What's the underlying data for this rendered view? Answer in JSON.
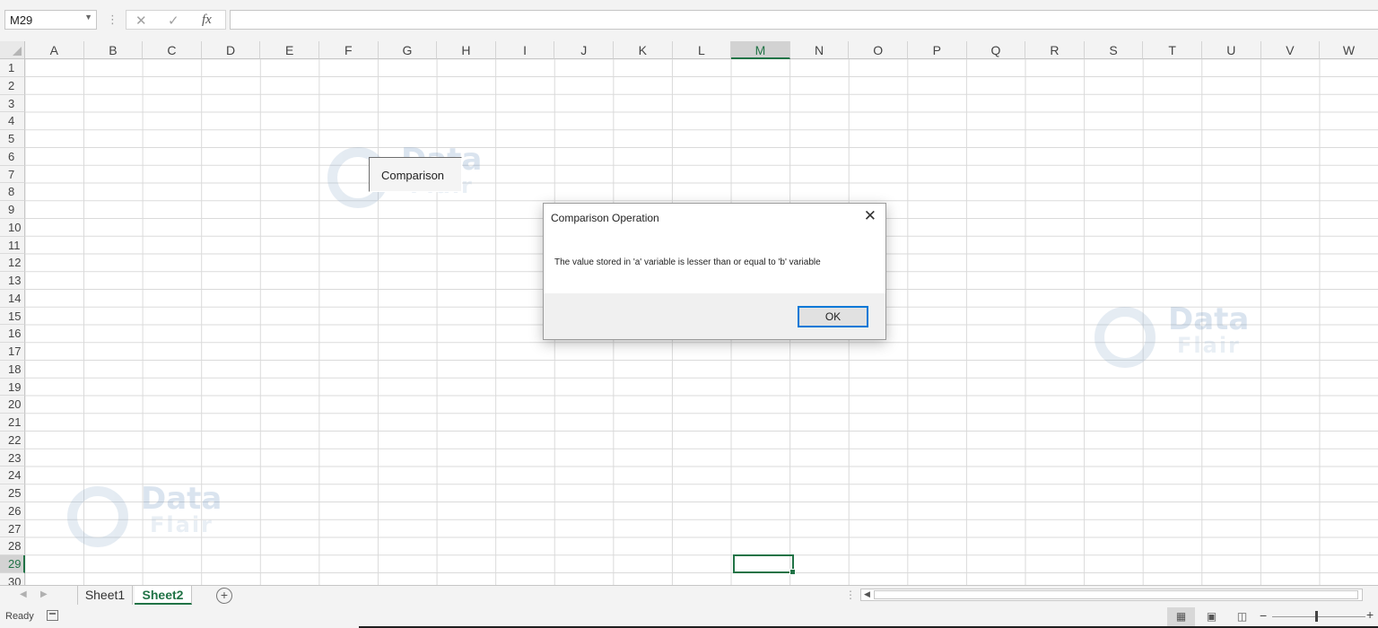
{
  "formula_bar": {
    "name_box": "M29",
    "cancel_icon": "close-icon",
    "enter_icon": "check-icon",
    "function_label": "fx",
    "formula_value": ""
  },
  "columns": [
    "A",
    "B",
    "C",
    "D",
    "E",
    "F",
    "G",
    "H",
    "I",
    "J",
    "K",
    "L",
    "M",
    "N",
    "O",
    "P",
    "Q",
    "R",
    "S",
    "T",
    "U",
    "V",
    "W"
  ],
  "rows": [
    "1",
    "2",
    "3",
    "4",
    "5",
    "6",
    "7",
    "8",
    "9",
    "10",
    "11",
    "12",
    "13",
    "14",
    "15",
    "16",
    "17",
    "18",
    "19",
    "20",
    "21",
    "22",
    "23",
    "24",
    "25",
    "26",
    "27",
    "28",
    "29",
    "30"
  ],
  "selected": {
    "column": "M",
    "row": "29"
  },
  "form_button": {
    "label": "Comparison"
  },
  "watermark": {
    "line1": "Data",
    "line2": "Flair"
  },
  "dialog": {
    "title": "Comparison Operation",
    "message": "The value stored in 'a' variable is lesser than or equal to 'b' variable",
    "ok_label": "OK",
    "close_icon": "close-icon"
  },
  "sheet_tabs": {
    "tabs": [
      "Sheet1",
      "Sheet2"
    ],
    "active": "Sheet2",
    "add_icon": "plus-circle-icon"
  },
  "status_bar": {
    "status": "Ready",
    "views": [
      "normal-view-icon",
      "page-layout-view-icon",
      "page-break-view-icon"
    ],
    "zoom_minus": "−",
    "zoom_plus": "+"
  },
  "colors": {
    "accent": "#217346",
    "dialog_focus": "#0078d7"
  }
}
